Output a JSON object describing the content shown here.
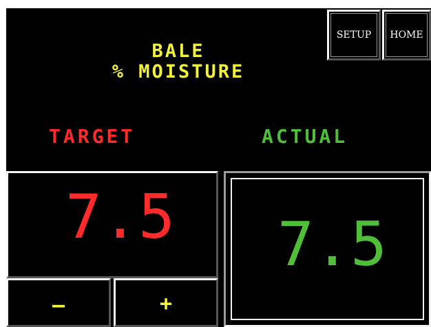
{
  "header": {
    "title_line1": "BALE",
    "title_line2": "% MOISTURE"
  },
  "nav": {
    "setup_label": "SETUP",
    "home_label": "HOME"
  },
  "target": {
    "label": "TARGET",
    "value": "7.5",
    "color": "#ff2a2a"
  },
  "actual": {
    "label": "ACTUAL",
    "value": "7.5",
    "color": "#4fbf3a"
  },
  "controls": {
    "decrease_label": "—",
    "increase_label": "+"
  },
  "colors": {
    "title": "#f2f23a",
    "background": "#000000",
    "bevel_light": "#f4f4f4"
  }
}
